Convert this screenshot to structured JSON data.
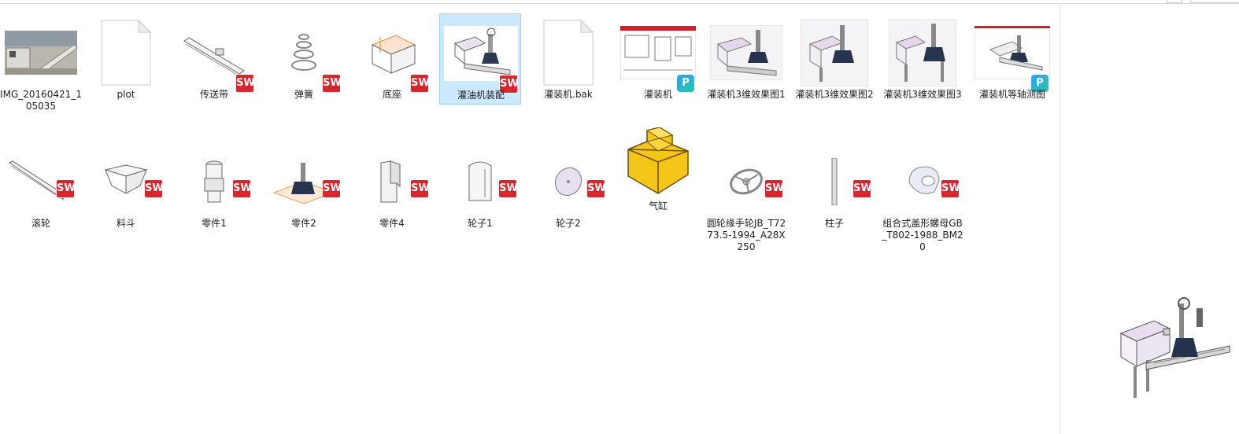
{
  "files": [
    {
      "label": "IMG_20160421_105035",
      "icon": "photo-thumbnail",
      "badge": ""
    },
    {
      "label": "plot",
      "icon": "blank-file-icon",
      "badge": ""
    },
    {
      "label": "传送带",
      "icon": "conveyor-part-thumbnail",
      "badge": "SW"
    },
    {
      "label": "弹簧",
      "icon": "spring-part-thumbnail",
      "badge": "SW"
    },
    {
      "label": "底座",
      "icon": "base-part-thumbnail",
      "badge": "SW"
    },
    {
      "label": "灌油机装配",
      "icon": "assembly-thumbnail",
      "badge": "SW",
      "selected": true
    },
    {
      "label": "灌装机.bak",
      "icon": "blank-file-icon",
      "badge": ""
    },
    {
      "label": "灌装机",
      "icon": "drawing-pdf-thumbnail",
      "badge": "P"
    },
    {
      "label": "灌装机3维效果图1",
      "icon": "render-thumbnail",
      "badge": ""
    },
    {
      "label": "灌装机3维效果图2",
      "icon": "render-thumbnail",
      "badge": ""
    },
    {
      "label": "灌装机3维效果图3",
      "icon": "render-thumbnail",
      "badge": ""
    },
    {
      "label": "灌装机等轴测图",
      "icon": "drawing-pdf-thumbnail",
      "badge": "P"
    },
    {
      "label": "滚轮",
      "icon": "roller-part-thumbnail",
      "badge": "SW"
    },
    {
      "label": "料斗",
      "icon": "hopper-part-thumbnail",
      "badge": "SW"
    },
    {
      "label": "零件1",
      "icon": "part1-thumbnail",
      "badge": "SW"
    },
    {
      "label": "零件2",
      "icon": "part2-thumbnail",
      "badge": "SW"
    },
    {
      "label": "零件4",
      "icon": "part4-thumbnail",
      "badge": "SW"
    },
    {
      "label": "轮子1",
      "icon": "wheel1-thumbnail",
      "badge": "SW"
    },
    {
      "label": "轮子2",
      "icon": "wheel2-thumbnail",
      "badge": "SW"
    },
    {
      "label": "气缸",
      "icon": "cylinder-block-icon",
      "badge": ""
    },
    {
      "label": "圆轮缘手轮JB_T7273.5-1994_A28X250",
      "icon": "handwheel-thumbnail",
      "badge": "SW"
    },
    {
      "label": "柱子",
      "icon": "column-part-thumbnail",
      "badge": "SW"
    },
    {
      "label": "组合式盖形螺母GB_T802-1988_BM20",
      "icon": "cap-nut-thumbnail",
      "badge": "SW"
    }
  ],
  "badges": {
    "sw": "SW",
    "pdf": "P"
  },
  "colors": {
    "selection_bg": "#cce8ff",
    "selection_border": "#99d1ff",
    "sw_red": "#d8262c",
    "pdf_blue": "#2ea0f5"
  },
  "preview": {
    "icon": "filling-machine-preview"
  }
}
